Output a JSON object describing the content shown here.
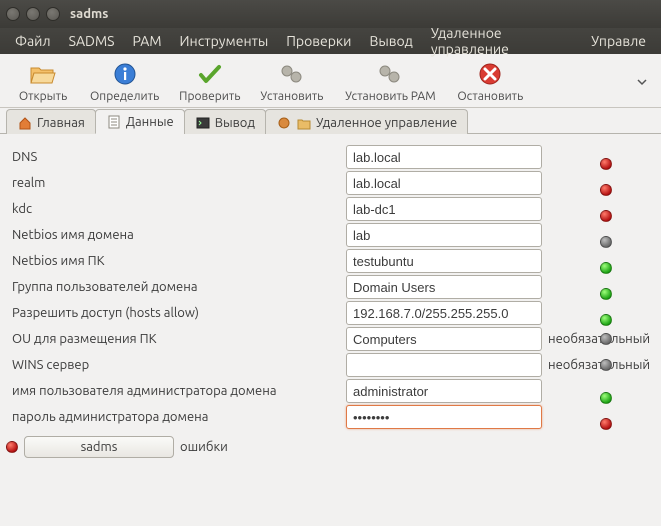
{
  "window": {
    "title": "sadms"
  },
  "menubar": {
    "items": [
      "Файл",
      "SADMS",
      "PAM",
      "Инструменты",
      "Проверки",
      "Вывод",
      "Удаленное управление",
      "Управле"
    ]
  },
  "toolbar": {
    "open": "Открыть",
    "detect": "Определить",
    "check": "Проверить",
    "install": "Установить",
    "install_pam": "Установить PAM",
    "stop": "Остановить"
  },
  "tabs": {
    "home": "Главная",
    "data": "Данные",
    "output": "Вывод",
    "remote": "Удаленное управление"
  },
  "form": {
    "rows": [
      {
        "label": "DNS",
        "value": "lab.local",
        "led": "red",
        "note": ""
      },
      {
        "label": "realm",
        "value": "lab.local",
        "led": "red",
        "note": ""
      },
      {
        "label": "kdc",
        "value": "lab-dc1",
        "led": "red",
        "note": ""
      },
      {
        "label": "Netbios имя домена",
        "value": "lab",
        "led": "grey",
        "note": ""
      },
      {
        "label": "Netbios имя ПК",
        "value": "testubuntu",
        "led": "green",
        "note": ""
      },
      {
        "label": "Группа пользователей домена",
        "value": "Domain Users",
        "led": "green",
        "note": ""
      },
      {
        "label": "Разрешить доступ (hosts allow)",
        "value": "192.168.7.0/255.255.255.0",
        "led": "green",
        "note": ""
      },
      {
        "label": "OU для размещения ПК",
        "value": "Computers",
        "led": "grey",
        "note": "необязательный"
      },
      {
        "label": "WINS сервер",
        "value": "",
        "led": "grey",
        "note": "необязательный"
      },
      {
        "label": "имя пользователя администратора домена",
        "value": "administrator",
        "led": "green",
        "note": ""
      },
      {
        "label": "пароль администратора домена",
        "value": "••••••••",
        "led": "red",
        "note": "",
        "focused": true
      }
    ]
  },
  "status": {
    "button": "sadms",
    "message": "ошибки"
  }
}
